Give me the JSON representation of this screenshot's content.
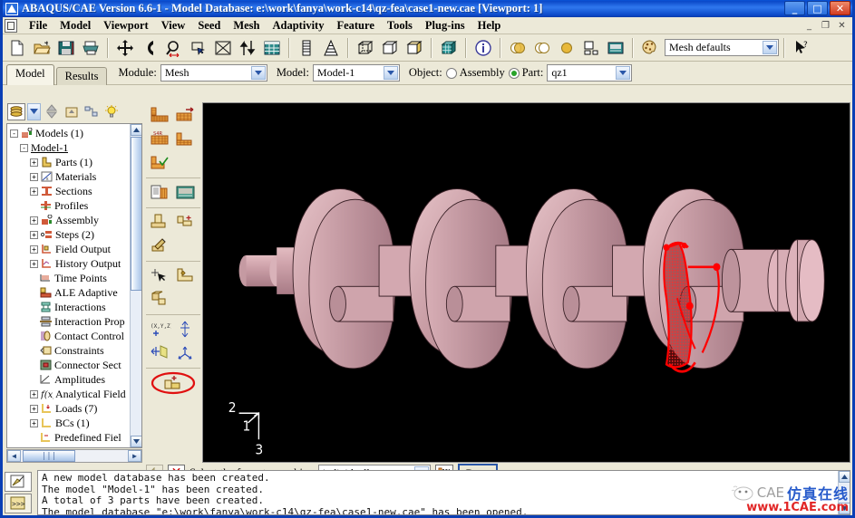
{
  "window": {
    "title": "ABAQUS/CAE Version 6.6-1 - Model Database: e:\\work\\fanya\\work-c14\\qz-fea\\case1-new.cae [Viewport: 1]",
    "app_icon": "abaqus-icon",
    "minimize": "_",
    "maximize": "□",
    "close": "✕"
  },
  "menu": {
    "items": [
      {
        "label": "File"
      },
      {
        "label": "Model"
      },
      {
        "label": "Viewport"
      },
      {
        "label": "View"
      },
      {
        "label": "Seed"
      },
      {
        "label": "Mesh"
      },
      {
        "label": "Adaptivity"
      },
      {
        "label": "Feature"
      },
      {
        "label": "Tools"
      },
      {
        "label": "Plug-ins"
      },
      {
        "label": "Help"
      }
    ],
    "mdi": {
      "minimize": "_",
      "restore": "❐",
      "close": "✕"
    }
  },
  "toolbar": {
    "groups": [
      [
        "new-file-icon",
        "open-file-icon",
        "save-icon",
        "print-icon"
      ],
      [
        "pan-icon",
        "rotate-icon",
        "magnify-icon",
        "box-zoom-icon",
        "fit-view-icon",
        "cycle-views-icon",
        "viewport-grid-icon"
      ],
      [
        "query-ruler-icon",
        "datum-stack-icon"
      ],
      [
        "wireframe-cube-icon",
        "hidden-line-cube-icon",
        "shaded-cube-icon"
      ],
      [
        "render-cube-icon"
      ],
      [
        "info-icon"
      ],
      [
        "overlay-icon",
        "transparency-icon",
        "single-disc-icon",
        "tile-windows-icon",
        "display-group-icon"
      ],
      [
        "color-palette-icon"
      ]
    ],
    "color_code_value": "Mesh defaults",
    "help_cursor_icon": "context-help-icon"
  },
  "context": {
    "tabs": [
      {
        "label": "Model",
        "active": true
      },
      {
        "label": "Results",
        "active": false
      }
    ],
    "module_label": "Module:",
    "module_value": "Mesh",
    "model_label": "Model:",
    "model_value": "Model-1",
    "object_label": "Object:",
    "object_assembly": "Assembly",
    "object_part": "Part:",
    "object_selected": "part",
    "part_value": "qz1"
  },
  "tree_toolbar": {
    "buttons": [
      "model-db-filter-icon",
      "filter-dropdown-icon",
      "updown-arrows-icon",
      "move-up-folder-icon",
      "dependencies-icon",
      "tip-bulb-icon"
    ]
  },
  "tree": {
    "nodes": [
      {
        "label": "Models (1)",
        "indent": 0,
        "expander": "-",
        "icon": "models-icon",
        "underline": false
      },
      {
        "label": "Model-1",
        "indent": 1,
        "expander": "-",
        "icon": "",
        "underline": true
      },
      {
        "label": "Parts (1)",
        "indent": 2,
        "expander": "+",
        "icon": "parts-icon",
        "underline": false
      },
      {
        "label": "Materials",
        "indent": 2,
        "expander": "+",
        "icon": "materials-icon",
        "underline": false
      },
      {
        "label": "Sections",
        "indent": 2,
        "expander": "+",
        "icon": "sections-icon",
        "underline": false
      },
      {
        "label": "Profiles",
        "indent": 2,
        "expander": "",
        "icon": "profiles-icon",
        "underline": false
      },
      {
        "label": "Assembly",
        "indent": 2,
        "expander": "+",
        "icon": "assembly-icon",
        "underline": false
      },
      {
        "label": "Steps (2)",
        "indent": 2,
        "expander": "+",
        "icon": "steps-icon",
        "underline": false
      },
      {
        "label": "Field Output",
        "indent": 2,
        "expander": "+",
        "icon": "field-output-icon",
        "underline": false
      },
      {
        "label": "History Output",
        "indent": 2,
        "expander": "+",
        "icon": "history-output-icon",
        "underline": false
      },
      {
        "label": "Time Points",
        "indent": 2,
        "expander": "",
        "icon": "time-points-icon",
        "underline": false
      },
      {
        "label": "ALE Adaptive",
        "indent": 2,
        "expander": "",
        "icon": "ale-adaptive-icon",
        "underline": false
      },
      {
        "label": "Interactions",
        "indent": 2,
        "expander": "",
        "icon": "interactions-icon",
        "underline": false
      },
      {
        "label": "Interaction Prop",
        "indent": 2,
        "expander": "",
        "icon": "interaction-prop-icon",
        "underline": false
      },
      {
        "label": "Contact Control",
        "indent": 2,
        "expander": "",
        "icon": "contact-controls-icon",
        "underline": false
      },
      {
        "label": "Constraints",
        "indent": 2,
        "expander": "",
        "icon": "constraints-icon",
        "underline": false
      },
      {
        "label": "Connector Sect",
        "indent": 2,
        "expander": "",
        "icon": "connector-sections-icon",
        "underline": false
      },
      {
        "label": "Amplitudes",
        "indent": 2,
        "expander": "",
        "icon": "amplitudes-icon",
        "underline": false
      },
      {
        "label": "Analytical Field",
        "indent": 2,
        "expander": "+",
        "icon": "analytical-fields-icon",
        "underline": false
      },
      {
        "label": "Loads (7)",
        "indent": 2,
        "expander": "+",
        "icon": "loads-icon",
        "underline": false
      },
      {
        "label": "BCs (1)",
        "indent": 2,
        "expander": "+",
        "icon": "bcs-icon",
        "underline": false
      },
      {
        "label": "Predefined Fiel",
        "indent": 2,
        "expander": "",
        "icon": "predefined-fields-icon",
        "underline": false
      }
    ]
  },
  "toolbox": {
    "groups": [
      [
        "mesh-part-icon",
        "assign-element-type-icon",
        "assign-mesh-controls-icon",
        "seed-part-icon",
        "verify-mesh-icon"
      ],
      [
        "mesh-stack-orient-icon",
        "mesh-display-icon"
      ],
      [
        "partition-cell-icon",
        "create-feature-icon",
        "edit-partition-icon"
      ],
      [
        "select-entity-icon",
        "create-partition-face-icon",
        "partition-solid-icon"
      ],
      [
        "create-datum-point-icon",
        "create-datum-axis-icon",
        "create-datum-plane-icon",
        "create-datum-csys-icon"
      ],
      [
        "combine-faces-icon"
      ]
    ],
    "active_tool": "combine-faces-icon"
  },
  "viewport": {
    "part_name": "qz1",
    "background": "#000000",
    "part_color": "#c49aa0",
    "highlight_color": "#ff0000",
    "triad": {
      "axis1": "1",
      "axis2": "2",
      "axis3": "3"
    }
  },
  "prompt": {
    "back_icon": "back-arrow-icon",
    "cancel_icon": "cancel-x-icon",
    "text": "Select the faces to combine",
    "method_value": "individually",
    "sets_icon": "select-from-sets-icon",
    "done_label": "Done"
  },
  "message": {
    "tabs": [
      "message-area-icon",
      "python-prompt-icon"
    ],
    "lines": [
      "A new model database has been created.",
      "The model \"Model-1\" has been created.",
      "A total of 3 parts have been created.",
      "The model database \"e:\\work\\fanya\\work-c14\\qz-fea\\case1-new.cae\" has been opened."
    ]
  },
  "watermark": {
    "brand": "CAE",
    "chinese": "仿真在线",
    "url": "www.1CAE.com"
  },
  "colors": {
    "titlebar": "#0b49c9",
    "face": "#ece9d8",
    "accent_red": "#e01b1b",
    "accent_blue": "#1c53c9"
  }
}
